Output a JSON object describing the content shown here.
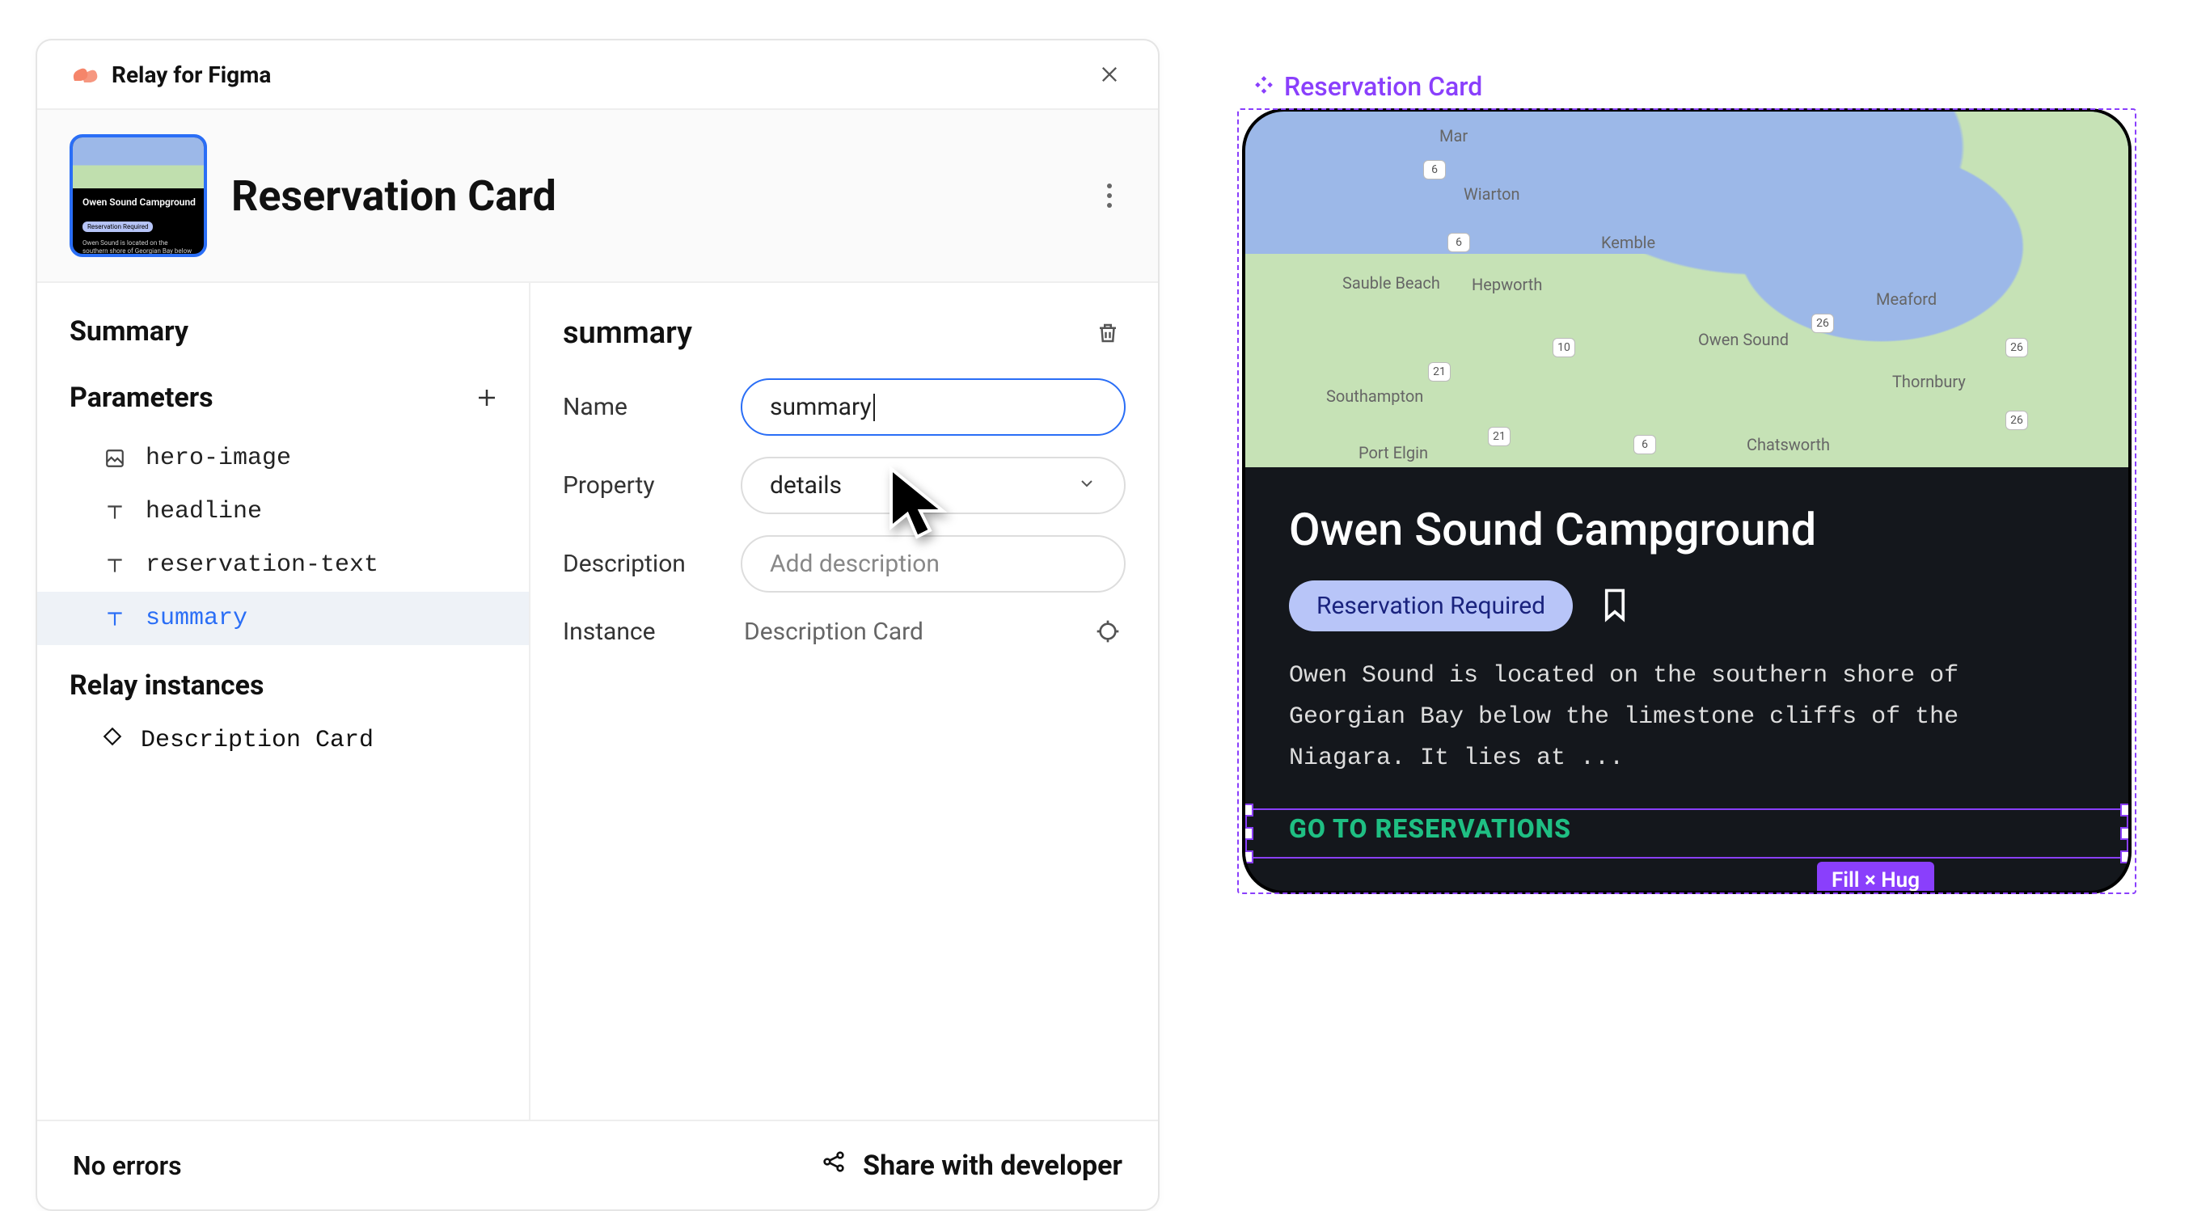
{
  "plugin": {
    "name": "Relay for Figma",
    "component_title": "Reservation Card",
    "thumb": {
      "headline": "Owen Sound Campground",
      "pill": "Reservation Required",
      "desc": "Owen Sound is located on the southern shore of Georgian Bay below the limestone cliffs of the Niagara. It lies at ...",
      "cta": "GO TO RESERVATIONS"
    }
  },
  "sidebar": {
    "summary_label": "Summary",
    "parameters_label": "Parameters",
    "params": [
      {
        "icon": "image",
        "name": "hero-image"
      },
      {
        "icon": "text",
        "name": "headline"
      },
      {
        "icon": "text",
        "name": "reservation-text"
      },
      {
        "icon": "text",
        "name": "summary",
        "active": true
      }
    ],
    "instances_label": "Relay instances",
    "instances": [
      {
        "name": "Description Card"
      }
    ]
  },
  "detail": {
    "heading": "summary",
    "name_label": "Name",
    "name_value": "summary",
    "property_label": "Property",
    "property_value": "details",
    "description_label": "Description",
    "description_placeholder": "Add description",
    "instance_label": "Instance",
    "instance_value": "Description Card"
  },
  "footer": {
    "status": "No errors",
    "share_label": "Share with developer"
  },
  "canvas": {
    "component_label": "Reservation Card",
    "selection_tag": "Fill × Hug",
    "map_labels": {
      "mar": "Mar",
      "wiarton": "Wiarton",
      "sauble": "Sauble Beach",
      "hepworth": "Hepworth",
      "kemble": "Kemble",
      "owen": "Owen Sound",
      "meaford": "Meaford",
      "thornbury": "Thornbury",
      "southampton": "Southampton",
      "portelgin": "Port Elgin",
      "chatsworth": "Chatsworth"
    },
    "roads": {
      "r6a": "6",
      "r6b": "6",
      "r6c": "6",
      "r10": "10",
      "r21a": "21",
      "r21b": "21",
      "r26a": "26",
      "r26b": "26",
      "r26c": "26"
    }
  },
  "card": {
    "headline": "Owen Sound Campground",
    "pill": "Reservation Required",
    "description": "Owen Sound is located on the southern shore of Georgian Bay below the limestone cliffs of the Niagara. It lies at ...",
    "cta": "GO TO RESERVATIONS"
  }
}
